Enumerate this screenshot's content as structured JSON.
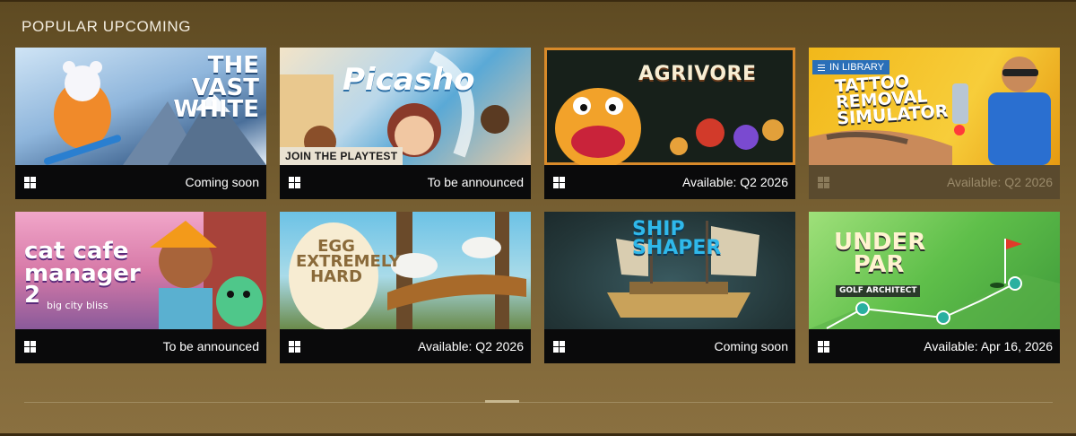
{
  "section": {
    "title": "POPULAR UPCOMING"
  },
  "games": [
    {
      "art_title": "THE VAST WHITE",
      "date": "Coming soon",
      "in_library": false,
      "playtest": false
    },
    {
      "art_title": "Picasho",
      "date": "To be announced",
      "in_library": false,
      "playtest": true,
      "playtest_label": "JOIN THE PLAYTEST"
    },
    {
      "art_title": "AGRIVORE",
      "date": "Available: Q2 2026",
      "in_library": false,
      "playtest": false
    },
    {
      "art_title": "TATTOO REMOVAL SIMULATOR",
      "date": "Available: Q2 2026",
      "in_library": true,
      "library_label": "IN LIBRARY"
    },
    {
      "art_title": "cat cafe manager 2",
      "art_subtitle": "big city bliss",
      "date": "To be announced",
      "in_library": false
    },
    {
      "art_title": "EGG EXTREMELY HARD",
      "date": "Available: Q2 2026",
      "in_library": false
    },
    {
      "art_title": "SHIP SHAPER",
      "date": "Coming soon",
      "in_library": false
    },
    {
      "art_title": "UNDER PAR",
      "art_subtitle": "GOLF ARCHITECT",
      "date": "Available: Apr 16, 2026",
      "in_library": false
    }
  ]
}
